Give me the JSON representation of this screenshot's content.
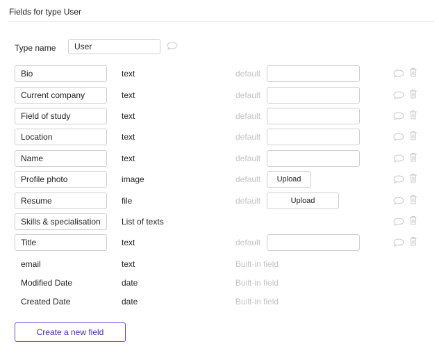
{
  "header": {
    "title": "Fields for type User"
  },
  "type_name": {
    "label": "Type name",
    "value": "User"
  },
  "default_label": "default",
  "builtin_label": "Built-in field",
  "upload_label": "Upload",
  "fields": [
    {
      "name": "Bio",
      "type": "text"
    },
    {
      "name": "Current company",
      "type": "text"
    },
    {
      "name": "Field of study",
      "type": "text"
    },
    {
      "name": "Location",
      "type": "text"
    },
    {
      "name": "Name",
      "type": "text"
    },
    {
      "name": "Profile photo",
      "type": "image"
    },
    {
      "name": "Resume",
      "type": "file"
    },
    {
      "name": "Skills & specialisation",
      "type": "List of texts"
    },
    {
      "name": "Title",
      "type": "text"
    }
  ],
  "builtin_fields": [
    {
      "name": "email",
      "type": "text"
    },
    {
      "name": "Modified Date",
      "type": "date"
    },
    {
      "name": "Created Date",
      "type": "date"
    }
  ],
  "create_button": {
    "label": "Create a new field"
  },
  "icons": {
    "comment": "comment-bubble-icon",
    "delete": "trash-icon"
  },
  "colors": {
    "accent": "#6b3fd6",
    "muted_text": "#c4c4c4",
    "border": "#cfcfcf"
  }
}
